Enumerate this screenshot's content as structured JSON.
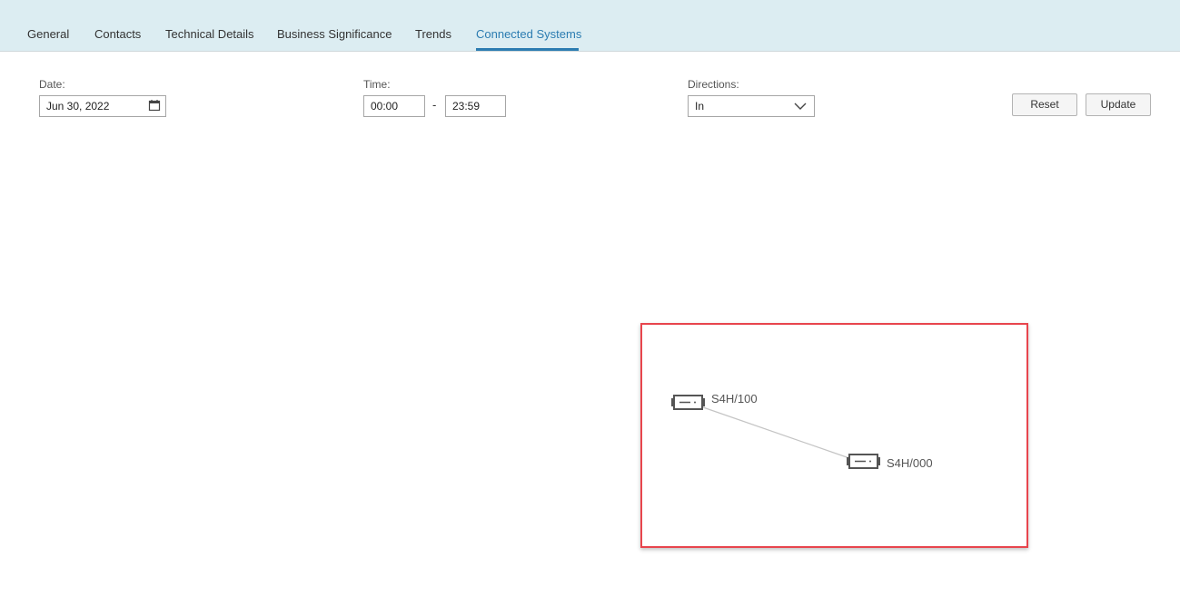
{
  "tabs": [
    {
      "label": "General"
    },
    {
      "label": "Contacts"
    },
    {
      "label": "Technical Details"
    },
    {
      "label": "Business Significance"
    },
    {
      "label": "Trends"
    },
    {
      "label": "Connected Systems",
      "active": true
    }
  ],
  "filters": {
    "date": {
      "label": "Date:",
      "value": "Jun 30, 2022"
    },
    "time": {
      "label": "Time:",
      "from": "00:00",
      "separator": "-",
      "to": "23:59"
    },
    "directions": {
      "label": "Directions:",
      "selected": "In"
    }
  },
  "buttons": {
    "reset": "Reset",
    "update": "Update"
  },
  "graph": {
    "nodes": [
      {
        "label": "S4H/100",
        "icon": "server-icon"
      },
      {
        "label": "S4H/000",
        "icon": "server-icon"
      }
    ],
    "highlight_color": "#e8454d"
  },
  "colors": {
    "accent": "#2b7cb1",
    "tab_bar": "#dcedf2"
  }
}
